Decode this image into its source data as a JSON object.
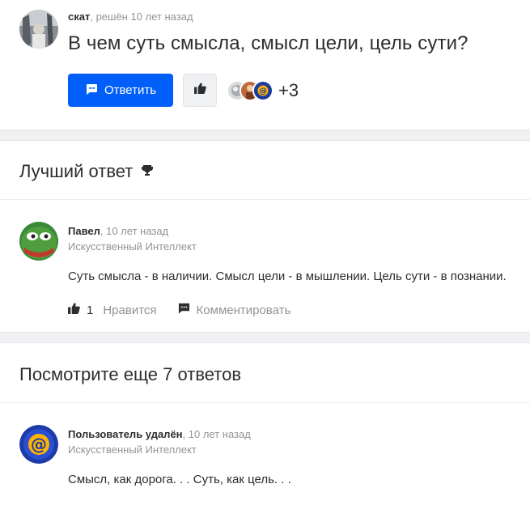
{
  "question": {
    "author": "скат",
    "status": ", решён 10 лет назад",
    "title": "В чем суть смысла, смысл цели, цель сути?",
    "reply_label": "Ответить",
    "likers_more": "+3"
  },
  "best_answer": {
    "heading": "Лучший ответ",
    "author": "Павел",
    "time": ", 10 лет назад",
    "rank": "Искусственный Интеллект",
    "text": "Суть смысла - в наличии. Смысл цели - в мышлении. Цель сути - в познании.",
    "likes": "1",
    "like_label": "Нравится",
    "comment_label": "Комментировать"
  },
  "more_answers": {
    "heading": "Посмотрите еще 7 ответов",
    "items": [
      {
        "author": "Пользователь удалён",
        "time": ", 10 лет назад",
        "rank": "Искусственный Интеллект",
        "text": "Смысл, как дорога. . . Суть, как цель. . ."
      }
    ]
  },
  "colors": {
    "primary": "#005ff9",
    "text": "#2c2d2e",
    "muted": "#919399",
    "separator": "#f0f1f3"
  }
}
